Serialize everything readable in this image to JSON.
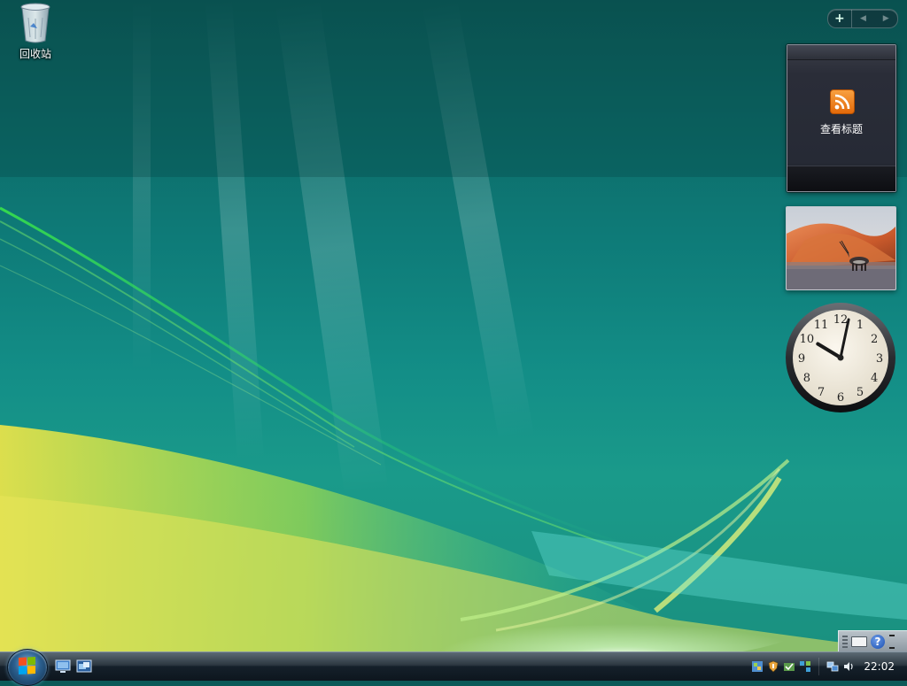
{
  "desktop": {
    "recycle_bin_label": "回收站"
  },
  "sidebar": {
    "add_symbol": "+",
    "prev_symbol": "◀",
    "next_symbol": "▶"
  },
  "feed_gadget": {
    "caption": "查看标题"
  },
  "clock": {
    "hour": 10,
    "minute": 2,
    "numerals": [
      "12",
      "1",
      "2",
      "3",
      "4",
      "5",
      "6",
      "7",
      "8",
      "9",
      "10",
      "11"
    ]
  },
  "language_bar": {
    "help_symbol": "?"
  },
  "taskbar": {
    "time": "22:02"
  },
  "icons": {
    "recycle_bin": "recycle-bin-icon",
    "rss": "rss-icon",
    "start": "windows-start-icon",
    "show_desktop": "show-desktop-icon",
    "switch_windows": "switch-windows-icon",
    "network": "network-icon",
    "security": "security-shield-icon",
    "volume": "volume-icon"
  },
  "colors": {
    "wallpaper_teal": "#0e7b78",
    "rss_orange": "#f08a1e",
    "taskbar_dark": "#15202a"
  }
}
